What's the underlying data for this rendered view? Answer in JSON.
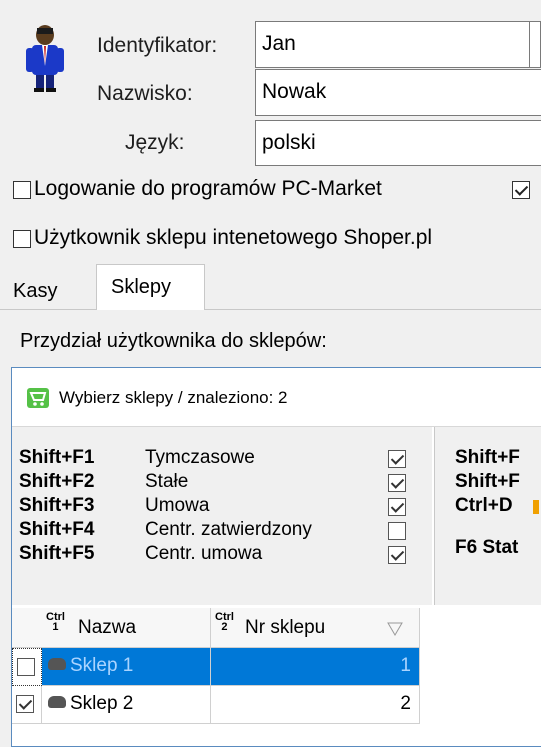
{
  "form": {
    "id_label": "Identyfikator:",
    "id_value": "Jan",
    "surname_label": "Nazwisko:",
    "surname_value": "Nowak",
    "language_label": "Język:",
    "language_value": "polski"
  },
  "checkboxes": {
    "pcmarket_label": "Logowanie do programów PC-Market",
    "pcmarket_checked": false,
    "extra_checked": true,
    "shoper_label": "Użytkownik sklepu intenetowego Shoper.pl",
    "shoper_checked": false
  },
  "tabs": [
    {
      "label": "Kasy",
      "active": false
    },
    {
      "label": "Sklepy",
      "active": true
    }
  ],
  "assign_label": "Przydział użytkownika do sklepów:",
  "panel": {
    "title": "Wybierz sklepy / znaleziono: 2",
    "filters": [
      {
        "key": "Shift+F1",
        "label": "Tymczasowe",
        "checked": true
      },
      {
        "key": "Shift+F2",
        "label": "Stałe",
        "checked": true
      },
      {
        "key": "Shift+F3",
        "label": "Umowa",
        "checked": true
      },
      {
        "key": "Shift+F4",
        "label": "Centr. zatwierdzony",
        "checked": false
      },
      {
        "key": "Shift+F5",
        "label": "Centr. umowa",
        "checked": true
      }
    ],
    "right_keys": [
      "Shift+F",
      "Shift+F",
      "Ctrl+D",
      "F6 Stat"
    ],
    "columns": [
      {
        "ctrl_top": "Ctrl",
        "ctrl_num": "1",
        "label": "Nazwa"
      },
      {
        "ctrl_top": "Ctrl",
        "ctrl_num": "2",
        "label": "Nr sklepu"
      }
    ],
    "rows": [
      {
        "checked": false,
        "name": "Sklep 1",
        "nr": "1",
        "selected": true
      },
      {
        "checked": true,
        "name": "Sklep 2",
        "nr": "2",
        "selected": false
      }
    ]
  },
  "colors": {
    "accent": "#0078d7",
    "cart": "#55c147"
  }
}
